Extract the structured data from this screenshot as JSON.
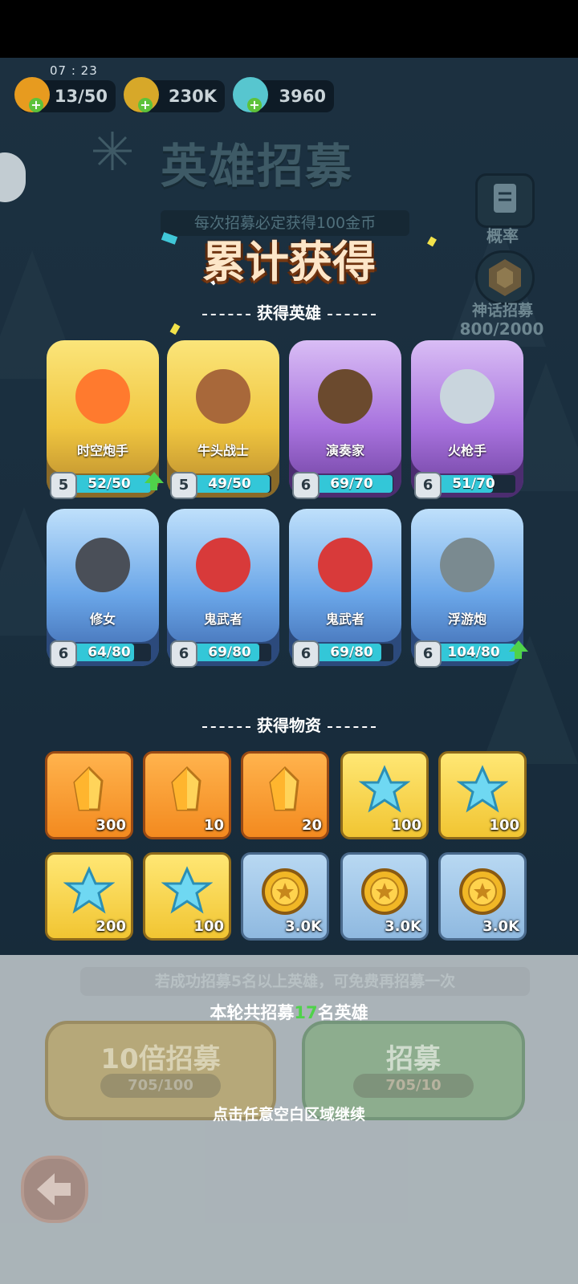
{
  "status": {
    "time": "07 : 23"
  },
  "resources": [
    {
      "name": "energy",
      "value": "13/50",
      "icon": "flame-icon",
      "color": "#e79b1f"
    },
    {
      "name": "gold",
      "value": "230K",
      "icon": "coin-icon",
      "color": "#d7a829"
    },
    {
      "name": "gems",
      "value": "3960",
      "icon": "crystal-icon",
      "color": "#57c6cf"
    }
  ],
  "background": {
    "title": "英雄招募",
    "subtitle": "每次招募必定获得100金币",
    "rate_label": "概率",
    "mythic_label": "神话招募",
    "mythic_progress": "800/2000"
  },
  "modal": {
    "title": "累计获得",
    "heroes_heading": "获得英雄",
    "items_heading": "获得物资",
    "summary_prefix": "本轮共招募",
    "summary_count": "17",
    "summary_suffix": "名英雄",
    "continue_hint": "点击任意空白区域继续"
  },
  "heroes": [
    {
      "name": "时空炮手",
      "level": "5",
      "progress": "52/50",
      "fill": 1.0,
      "rarity": "gold",
      "upgradable": true,
      "accent": "#ff7a2e"
    },
    {
      "name": "牛头战士",
      "level": "5",
      "progress": "49/50",
      "fill": 0.98,
      "rarity": "gold",
      "upgradable": false,
      "accent": "#a8683a"
    },
    {
      "name": "演奏家",
      "level": "6",
      "progress": "69/70",
      "fill": 0.986,
      "rarity": "purple",
      "upgradable": false,
      "accent": "#6b4a2e"
    },
    {
      "name": "火枪手",
      "level": "6",
      "progress": "51/70",
      "fill": 0.73,
      "rarity": "purple",
      "upgradable": false,
      "accent": "#c9d5dd"
    },
    {
      "name": "修女",
      "level": "6",
      "progress": "64/80",
      "fill": 0.8,
      "rarity": "blue",
      "upgradable": false,
      "accent": "#4a4f58"
    },
    {
      "name": "鬼武者",
      "level": "6",
      "progress": "69/80",
      "fill": 0.86,
      "rarity": "blue",
      "upgradable": false,
      "accent": "#d83a3a"
    },
    {
      "name": "鬼武者",
      "level": "6",
      "progress": "69/80",
      "fill": 0.86,
      "rarity": "blue",
      "upgradable": false,
      "accent": "#d83a3a"
    },
    {
      "name": "浮游炮",
      "level": "6",
      "progress": "104/80",
      "fill": 1.0,
      "rarity": "blue",
      "upgradable": true,
      "accent": "#7a8a90"
    }
  ],
  "items": [
    {
      "kind": "gold-crystal",
      "icon": "gold-crystal-icon",
      "qty": "300",
      "frame": "orange"
    },
    {
      "kind": "gold-crystal",
      "icon": "gold-crystal-icon",
      "qty": "10",
      "frame": "orange"
    },
    {
      "kind": "gold-crystal",
      "icon": "gold-crystal-icon",
      "qty": "20",
      "frame": "orange"
    },
    {
      "kind": "blue-crystal",
      "icon": "blue-crystal-icon",
      "qty": "100",
      "frame": "yellow"
    },
    {
      "kind": "blue-crystal",
      "icon": "blue-crystal-icon",
      "qty": "100",
      "frame": "yellow"
    },
    {
      "kind": "blue-crystal",
      "icon": "blue-crystal-icon",
      "qty": "200",
      "frame": "yellow"
    },
    {
      "kind": "blue-crystal",
      "icon": "blue-crystal-icon",
      "qty": "100",
      "frame": "yellow"
    },
    {
      "kind": "coin",
      "icon": "coin-icon",
      "qty": "3.0K",
      "frame": "sky"
    },
    {
      "kind": "coin",
      "icon": "coin-icon",
      "qty": "3.0K",
      "frame": "sky"
    },
    {
      "kind": "coin",
      "icon": "coin-icon",
      "qty": "3.0K",
      "frame": "sky"
    }
  ],
  "footer": {
    "tip": "若成功招募5名以上英雄，可免费再招募一次",
    "btn10_label": "10倍招募",
    "btn10_cost": "705/100",
    "btn1_label": "招募",
    "btn1_cost": "705/10"
  },
  "colors": {
    "title_fill": "#fde6c8",
    "title_stroke": "#7a3a12",
    "highlight_green": "#4fd24a",
    "bar_fill": "#33c7d8"
  }
}
